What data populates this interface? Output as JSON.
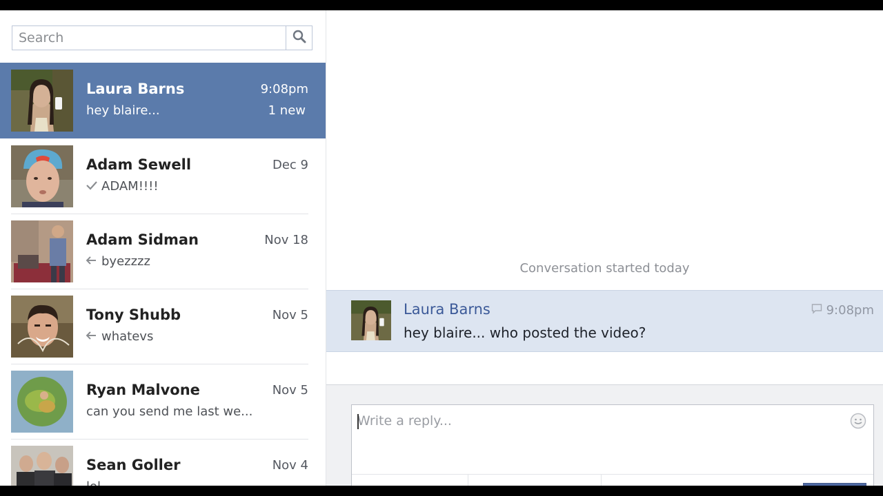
{
  "search": {
    "placeholder": "Search"
  },
  "threads": [
    {
      "name": "Laura Barns",
      "snippet": "hey blaire...",
      "time": "9:08pm",
      "badge": "1 new",
      "status_icon": "",
      "selected": true
    },
    {
      "name": "Adam Sewell",
      "snippet": "ADAM!!!!",
      "time": "Dec 9",
      "status_icon": "check-icon"
    },
    {
      "name": "Adam Sidman",
      "snippet": "byezzzz",
      "time": "Nov 18",
      "status_icon": "reply-arrow-icon"
    },
    {
      "name": "Tony Shubb",
      "snippet": "whatevs",
      "time": "Nov 5",
      "status_icon": "reply-arrow-icon"
    },
    {
      "name": "Ryan Malvone",
      "snippet": "can you send me last we...",
      "time": "Nov 5",
      "status_icon": ""
    },
    {
      "name": "Sean Goller",
      "snippet": "lol",
      "time": "Nov 4",
      "status_icon": ""
    }
  ],
  "conversation": {
    "started_label": "Conversation started today",
    "message": {
      "sender": "Laura Barns",
      "text": "hey blaire... who posted the video?",
      "time": "9:08pm"
    }
  },
  "reply": {
    "placeholder": "Write a reply..."
  },
  "colors": {
    "selected_thread_bg": "#5b7bab",
    "message_bg": "#dde5f1",
    "sender_name": "#3b5998"
  }
}
